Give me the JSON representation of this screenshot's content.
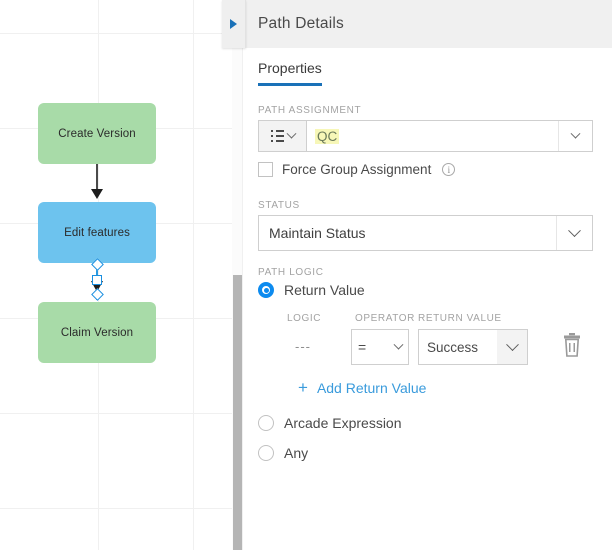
{
  "canvas": {
    "nodes": [
      {
        "label": "Create Version",
        "type": "version-node",
        "color": "#a8dba8"
      },
      {
        "label": "Edit features",
        "type": "edit-node",
        "color": "#6dc3ee"
      },
      {
        "label": "Claim Version",
        "type": "version-node",
        "color": "#a8dba8"
      }
    ],
    "selected_connector_color": "#1a8fe0"
  },
  "panel": {
    "header": {
      "title": "Path Details",
      "collapse_icon": "triangle-right-icon"
    },
    "tabs": [
      {
        "label": "Properties",
        "active": true
      }
    ],
    "path_assignment": {
      "label": "PATH ASSIGNMENT",
      "type_icon": "list-icon",
      "value": "QC",
      "highlight_color": "#f7f7b8",
      "caret_icon": "chevron-down-icon"
    },
    "force_group_assignment": {
      "label": "Force Group Assignment",
      "checked": false,
      "info_icon": "info-icon",
      "info_glyph": "i"
    },
    "status": {
      "label": "STATUS",
      "value": "Maintain Status",
      "caret_icon": "chevron-down-icon"
    },
    "path_logic": {
      "label": "PATH LOGIC",
      "options": [
        {
          "label": "Return Value",
          "selected": true
        },
        {
          "label": "Arcade Expression",
          "selected": false
        },
        {
          "label": "Any",
          "selected": false
        }
      ],
      "selected_color": "#0d8bef"
    },
    "return_value_table": {
      "headers": [
        "LOGIC",
        "OPERATOR",
        "RETURN VALUE"
      ],
      "rows": [
        {
          "logic": "---",
          "operator": "=",
          "return_value": "Success",
          "delete_icon": "trash-icon"
        }
      ],
      "add_label": "Add Return Value",
      "add_icon": "plus-icon",
      "link_color": "#3a9bdc"
    }
  }
}
